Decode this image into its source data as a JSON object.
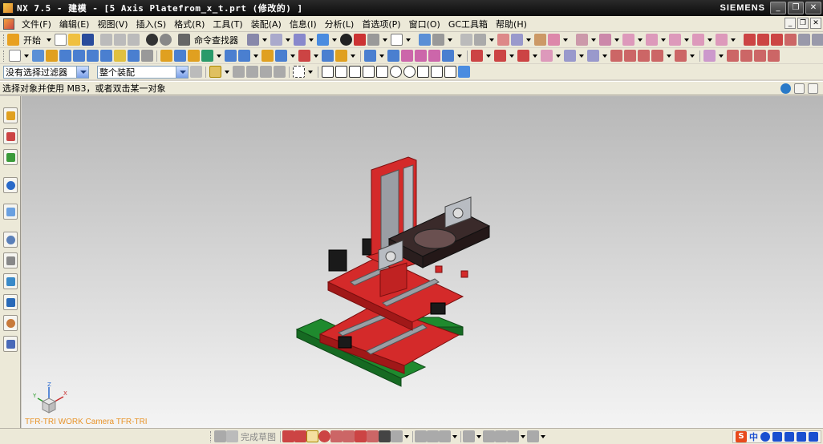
{
  "window": {
    "title": "NX 7.5 - 建模 - [5 Axis Platefrom_x_t.prt  (修改的) ]",
    "brand": "SIEMENS",
    "buttons": {
      "minimize": "_",
      "restore": "❐",
      "close": "✕"
    }
  },
  "menubar": {
    "items": [
      "文件(F)",
      "编辑(E)",
      "视图(V)",
      "插入(S)",
      "格式(R)",
      "工具(T)",
      "装配(A)",
      "信息(I)",
      "分析(L)",
      "首选项(P)",
      "窗口(O)",
      "GC工具箱",
      "帮助(H)"
    ]
  },
  "toolbar1": {
    "start_label": "开始",
    "command_finder_label": "命令查找器"
  },
  "selection_bar": {
    "filter_value": "没有选择过滤器",
    "scope_value": "整个装配"
  },
  "cue_line": {
    "text": "选择对象并使用 MB3，或者双击某一对象"
  },
  "viewport": {
    "view_label": "TFR-TRI WORK Camera TFR-TRI",
    "triad": {
      "x": "X",
      "y": "Y",
      "z": "Z"
    }
  },
  "bottom_toolbar": {
    "finish_sketch_label": "完成草图"
  },
  "ime": {
    "logo": "S",
    "mode": "中"
  },
  "colors": {
    "frame_red": "#d42a2a",
    "base_green": "#1f8a2e",
    "rail_gray": "#9a9ea4",
    "black_part": "#1a1a1a",
    "view_label": "#e8942a"
  }
}
